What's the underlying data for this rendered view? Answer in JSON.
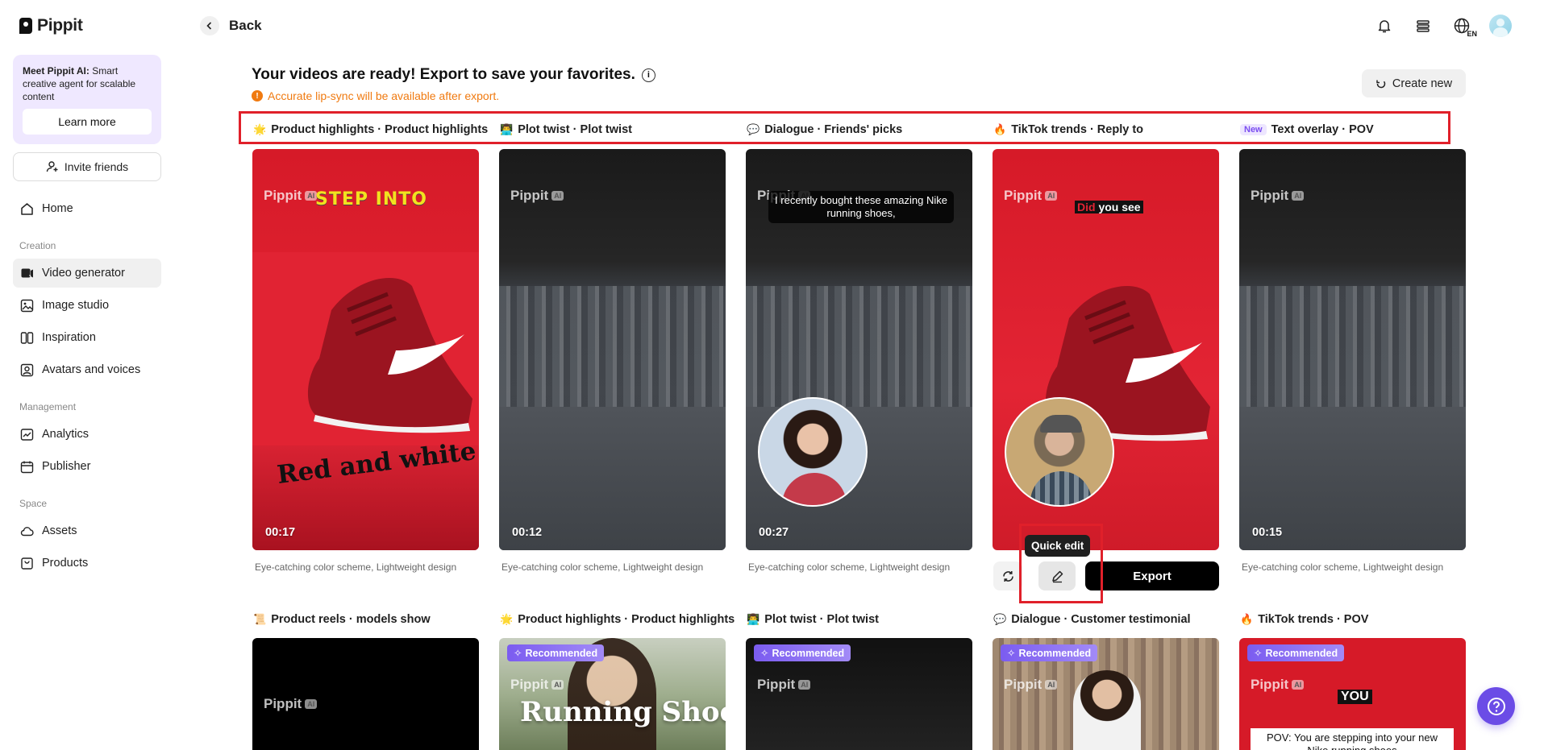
{
  "app": {
    "name": "Pippit"
  },
  "promo": {
    "bold": "Meet Pippit AI:",
    "text": " Smart creative agent for scalable content",
    "button": "Learn more"
  },
  "invite": {
    "label": "Invite friends"
  },
  "nav": {
    "home": "Home",
    "sections": {
      "creation": "Creation",
      "management": "Management",
      "space": "Space"
    },
    "creation": [
      "Video generator",
      "Image studio",
      "Inspiration",
      "Avatars and voices"
    ],
    "management": [
      "Analytics",
      "Publisher"
    ],
    "space": [
      "Assets",
      "Products"
    ],
    "active": "Video generator"
  },
  "header": {
    "back": "Back",
    "lang": "EN"
  },
  "main": {
    "title": "Your videos are ready! Export to save your favorites.",
    "warning": "Accurate lip-sync will be available after export.",
    "create_new": "Create new"
  },
  "row1": [
    {
      "emoji": "🌟",
      "label": "Product highlights · Product highlights",
      "duration": "00:17",
      "caption": "Eye-catching color scheme, Lightweight design",
      "overlay_top": "STEP INTO",
      "overlay_bottom": "Red and white"
    },
    {
      "emoji": "👨‍💻",
      "label": "Plot twist · Plot twist",
      "duration": "00:12",
      "caption": "Eye-catching color scheme, Lightweight design"
    },
    {
      "emoji": "💬",
      "label": "Dialogue · Friends' picks",
      "duration": "00:27",
      "caption": "Eye-catching color scheme, Lightweight design",
      "bubble": "I recently bought these amazing Nike running shoes,"
    },
    {
      "emoji": "🔥",
      "label": "TikTok trends · Reply to",
      "overlay_a": "Did",
      "overlay_b": " you see"
    },
    {
      "badge": "New",
      "label": "Text overlay · POV",
      "duration": "00:15",
      "caption": "Eye-catching color scheme, Lightweight design"
    }
  ],
  "watermark": {
    "name": "Pippit",
    "ai": "AI"
  },
  "actions": {
    "tooltip": "Quick edit",
    "export": "Export"
  },
  "row2": [
    {
      "emoji": "📜",
      "label": "Product reels · models show"
    },
    {
      "emoji": "🌟",
      "label": "Product highlights · Product highlights",
      "recommended": "Recommended",
      "overlay": "Running Shoe"
    },
    {
      "emoji": "👨‍💻",
      "label": "Plot twist · Plot twist",
      "recommended": "Recommended"
    },
    {
      "emoji": "💬",
      "label": "Dialogue · Customer testimonial",
      "recommended": "Recommended"
    },
    {
      "emoji": "🔥",
      "label": "TikTok trends · POV",
      "recommended": "Recommended",
      "overlay": "YOU",
      "overlay2": "POV: You are stepping into your new Nike running shoes"
    }
  ],
  "colors": {
    "accent": "#6b4ce6",
    "warning": "#f07a10",
    "highlight": "#e0202a",
    "promo_bg": "#efe8ff"
  }
}
